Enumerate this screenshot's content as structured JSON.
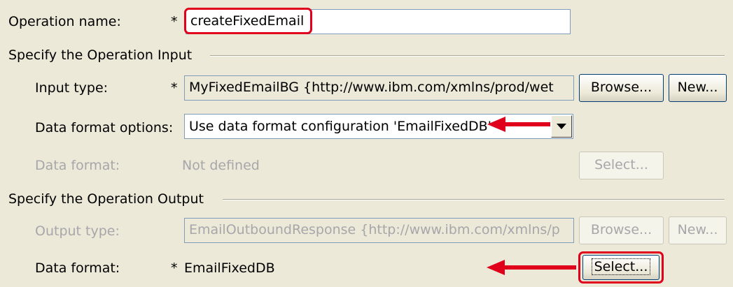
{
  "operation": {
    "label": "Operation name:",
    "required_mark": "*",
    "value": "createFixedEmail"
  },
  "input_section": {
    "heading": "Specify the Operation Input",
    "input_type_label": "Input type:",
    "input_type_required": "*",
    "input_type_value": "MyFixedEmailBG  {http://www.ibm.com/xmlns/prod/wet",
    "browse_label": "Browse...",
    "new_label": "New...",
    "data_format_options_label": "Data format options:",
    "data_format_options_value": "Use data format configuration 'EmailFixedDB'",
    "data_format_label": "Data format:",
    "data_format_value": "Not defined",
    "select_label": "Select..."
  },
  "output_section": {
    "heading": "Specify the Operation Output",
    "output_type_label": "Output type:",
    "output_type_value": "EmailOutboundResponse  {http://www.ibm.com/xmlns/p",
    "browse_label": "Browse...",
    "new_label": "New...",
    "data_format_label": "Data format:",
    "data_format_required": "*",
    "data_format_value": "EmailFixedDB",
    "select_label": "Select..."
  },
  "annotation_color": "#e0001b"
}
